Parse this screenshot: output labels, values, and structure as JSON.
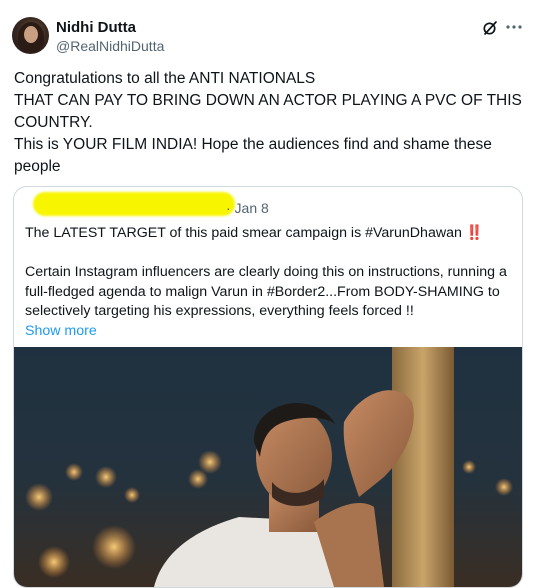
{
  "author": {
    "display_name": "Nidhi Dutta",
    "handle": "@RealNidhiDutta",
    "avatar_icon": "profile-photo"
  },
  "header_icons": {
    "grok": "grok-icon",
    "more": "more-icon"
  },
  "tweet": {
    "lines": [
      "Congratulations to all the ANTI NATIONALS",
      "THAT CAN PAY TO BRING DOWN AN ACTOR PLAYING A PVC OF THIS",
      "COUNTRY.",
      "This is YOUR FILM INDIA! Hope the audiences find and shame these",
      "people"
    ]
  },
  "quoted": {
    "highlight_color": "#f7f500",
    "date": "· Jan 8",
    "line1": "The LATEST TARGET of this paid smear campaign is #VarunDhawan",
    "line1_emoji": "‼️",
    "para2": [
      "Certain Instagram influencers are clearly doing this on instructions, running a",
      "full-fledged agenda to malign Varun in #Border2...From BODY-SHAMING to",
      "selectively targeting his expressions, everything feels forced !!"
    ],
    "show_more": "Show more",
    "image_alt": "actor-photo"
  },
  "colors": {
    "link": "#1d9bf0",
    "secondary_text": "#536471",
    "border": "#cfd9de"
  }
}
